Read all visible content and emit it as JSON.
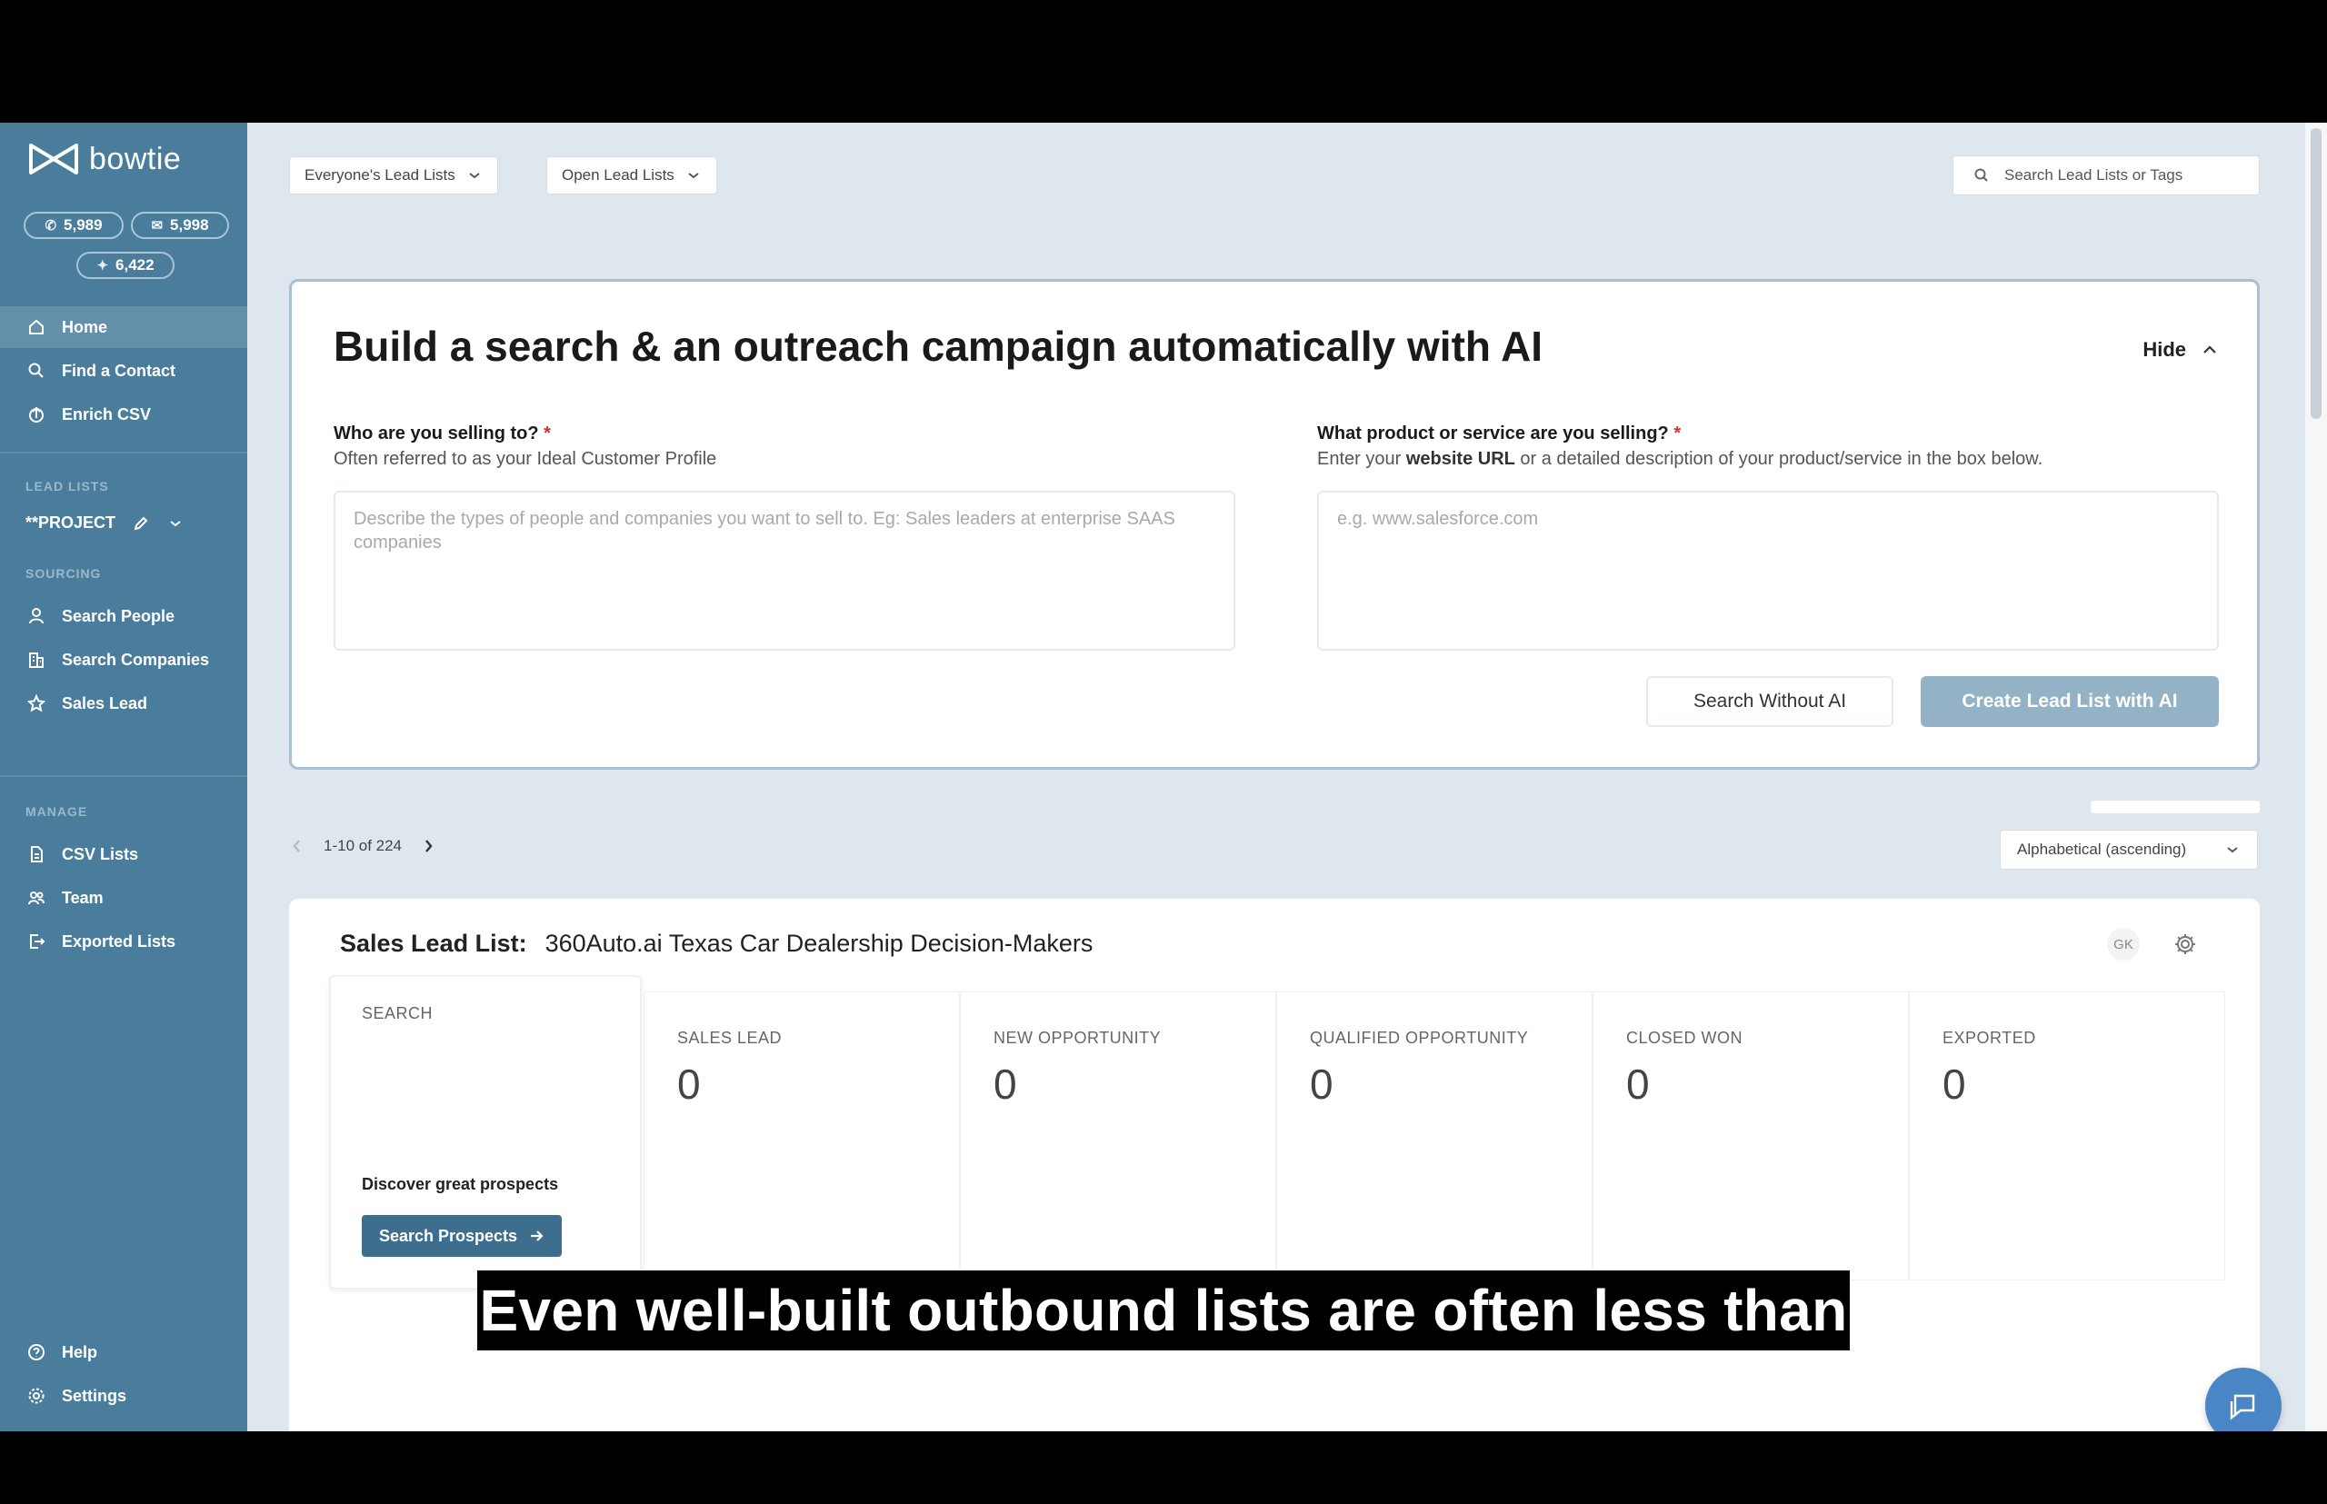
{
  "brand": {
    "name": "bowtie"
  },
  "credits": {
    "phone": "5,989",
    "email": "5,998",
    "ai": "6,422"
  },
  "sidebar": {
    "nav": [
      {
        "label": "Home",
        "icon": "home-icon"
      },
      {
        "label": "Find a Contact",
        "icon": "search-icon"
      },
      {
        "label": "Enrich CSV",
        "icon": "upload-icon"
      }
    ],
    "lead_lists_label": "LEAD LISTS",
    "project": "**PROJECT",
    "sourcing_label": "SOURCING",
    "sourcing": [
      {
        "label": "Search People",
        "icon": "person-icon"
      },
      {
        "label": "Search Companies",
        "icon": "building-icon"
      },
      {
        "label": "Sales Lead",
        "icon": "star-icon"
      }
    ],
    "manage_label": "MANAGE",
    "manage": [
      {
        "label": "CSV Lists",
        "icon": "file-icon"
      },
      {
        "label": "Team",
        "icon": "team-icon"
      },
      {
        "label": "Exported Lists",
        "icon": "export-icon"
      }
    ],
    "bottom": [
      {
        "label": "Help",
        "icon": "help-icon"
      },
      {
        "label": "Settings",
        "icon": "settings-icon"
      }
    ]
  },
  "topbar": {
    "filter_owner": "Everyone's Lead Lists",
    "filter_status": "Open Lead Lists",
    "search_placeholder": "Search Lead Lists or Tags"
  },
  "ai_card": {
    "title": "Build a search & an outreach campaign automatically with AI",
    "hide_label": "Hide",
    "q1_label": "Who are you selling to?",
    "q1_hint": "Often referred to as your Ideal Customer Profile",
    "q1_placeholder": "Describe the types of people and companies you want to sell to. Eg: Sales leaders at enterprise SAAS companies",
    "q2_label": "What product or service are you selling?",
    "q2_hint_pre": "Enter your ",
    "q2_hint_bold": "website URL",
    "q2_hint_post": " or a detailed description of your product/service in the box below.",
    "q2_placeholder": "e.g. www.salesforce.com",
    "required_mark": "*",
    "btn_search": "Search Without AI",
    "btn_create": "Create Lead List with AI"
  },
  "pagination": {
    "range": "1-10 of 224",
    "sort": "Alphabetical (ascending)"
  },
  "lead_card": {
    "label": "Sales Lead List:",
    "name": "360Auto.ai Texas Car Dealership Decision-Makers",
    "owner_initials": "GK",
    "search_label": "SEARCH",
    "discover": "Discover great prospects",
    "search_btn": "Search Prospects",
    "stages": [
      {
        "label": "SALES LEAD",
        "count": "0"
      },
      {
        "label": "NEW OPPORTUNITY",
        "count": "0"
      },
      {
        "label": "QUALIFIED OPPORTUNITY",
        "count": "0"
      },
      {
        "label": "CLOSED WON",
        "count": "0"
      },
      {
        "label": "EXPORTED",
        "count": "0"
      }
    ]
  },
  "caption": "Even well-built outbound lists are often less than"
}
